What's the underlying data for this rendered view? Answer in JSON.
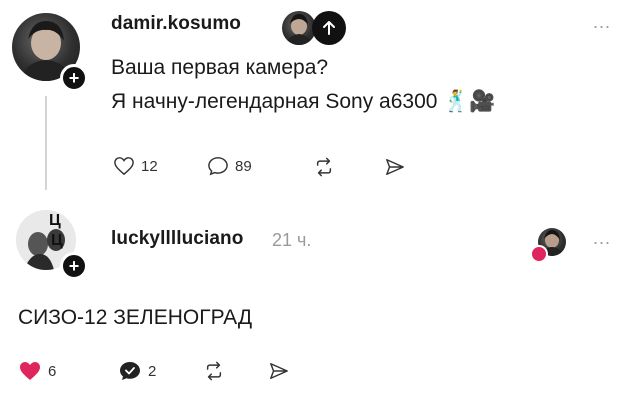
{
  "post1": {
    "username": "damir.kosumo",
    "lines": [
      "Ваша первая камера?",
      "Я начну-легендарная Sony a6300 🕺🎥"
    ],
    "likes": "12",
    "comments": "89",
    "more": "..."
  },
  "post2": {
    "username": "luckylllluciano",
    "time": "21 ч.",
    "text": "СИЗО-12 ЗЕЛЕНОГРАД",
    "likes": "6",
    "comments": "2",
    "more": "...",
    "avatar_letters": [
      "Ц",
      "Ц"
    ]
  },
  "colors": {
    "like_red": "#e0245e",
    "text": "#1a1a1a",
    "muted": "#9a9a9a"
  }
}
